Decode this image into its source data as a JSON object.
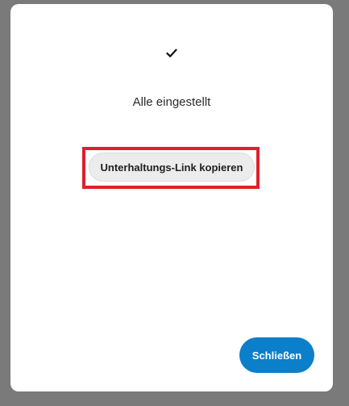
{
  "dialog": {
    "icon": "checkmark-icon",
    "message": "Alle eingestellt",
    "copy_link_label": "Unterhaltungs-Link kopieren",
    "close_label": "Schließen"
  },
  "colors": {
    "backdrop": "#7a7a7a",
    "dialog_background": "#ffffff",
    "close_button": "#0b7fca",
    "copy_button": "#ececec",
    "highlight": "#e0202b"
  }
}
